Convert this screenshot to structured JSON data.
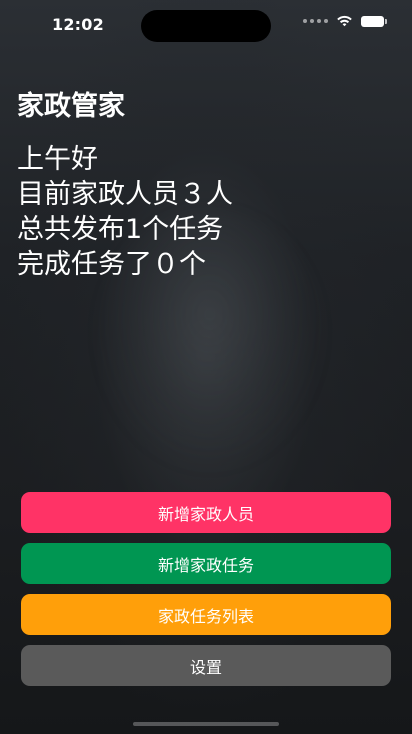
{
  "status_bar": {
    "time": "12:02",
    "signal_icon": "signal-dots-icon",
    "wifi_icon": "wifi-icon",
    "battery_icon": "battery-icon"
  },
  "header": {
    "title": "家政管家"
  },
  "summary": {
    "greeting": "上午好",
    "staff_count_text": "目前家政人员３人",
    "published_tasks_text": "总共发布1个任务",
    "completed_tasks_text": "完成任务了０个"
  },
  "actions": [
    {
      "label": "新增家政人员",
      "color": "#ff3366"
    },
    {
      "label": "新增家政任务",
      "color": "#009652"
    },
    {
      "label": "家政任务列表",
      "color": "#ff9f0a"
    },
    {
      "label": "设置",
      "color": "#5a5a5a"
    }
  ],
  "colors": {
    "background": "#1a1d21",
    "text": "#ffffff"
  }
}
